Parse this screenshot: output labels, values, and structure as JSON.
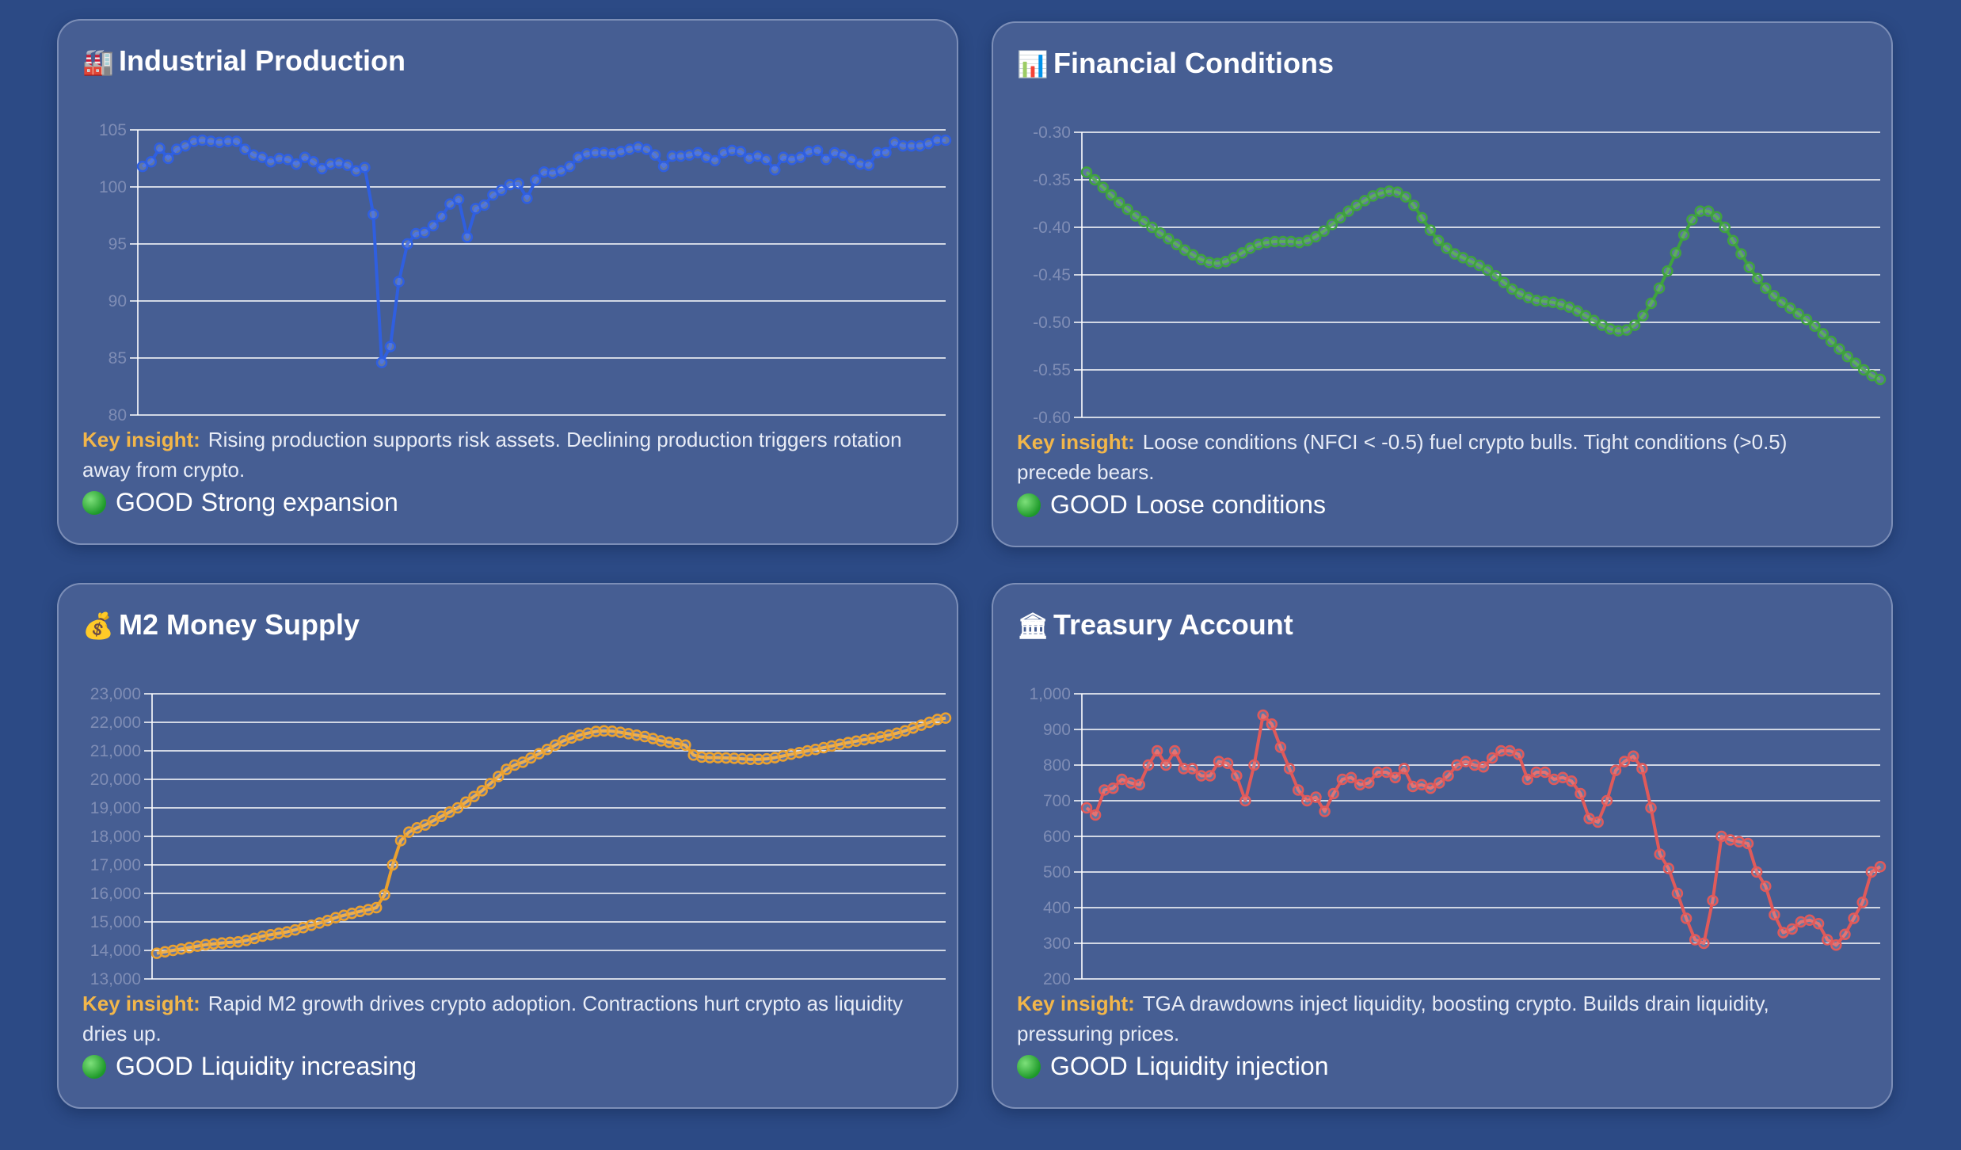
{
  "cards": [
    {
      "title": "Industrial Production",
      "icon": "🏭",
      "icon_name": "factory-icon",
      "insight_label": "Key insight:",
      "insight_text": "Rising production supports risk assets. Declining production triggers rotation away from crypto.",
      "status_word": "GOOD",
      "status_text": "Strong expansion",
      "status_icon": "green-circle-icon"
    },
    {
      "title": "Financial Conditions",
      "icon": "📊",
      "icon_name": "bar-chart-icon",
      "insight_label": "Key insight:",
      "insight_text": "Loose conditions (NFCI < -0.5) fuel crypto bulls. Tight conditions (>0.5) precede bears.",
      "status_word": "GOOD",
      "status_text": "Loose conditions",
      "status_icon": "green-circle-icon"
    },
    {
      "title": "M2 Money Supply",
      "icon": "💰",
      "icon_name": "money-bag-icon",
      "insight_label": "Key insight:",
      "insight_text": "Rapid M2 growth drives crypto adoption. Contractions hurt crypto as liquidity dries up.",
      "status_word": "GOOD",
      "status_text": "Liquidity increasing",
      "status_icon": "green-circle-icon"
    },
    {
      "title": "Treasury Account",
      "icon": "🏛",
      "icon_name": "bank-icon",
      "insight_label": "Key insight:",
      "insight_text": "TGA drawdowns inject liquidity, boosting crypto. Builds drain liquidity, pressuring prices.",
      "status_word": "GOOD",
      "status_text": "Liquidity injection",
      "status_icon": "green-circle-icon"
    }
  ],
  "chart_data": [
    {
      "type": "line",
      "color": "#2f5fe0",
      "ylim": [
        80,
        105
      ],
      "yticks": [
        80,
        85,
        90,
        95,
        100,
        105
      ],
      "y_tick_labels": [
        "80",
        "85",
        "90",
        "95",
        "100",
        "105"
      ],
      "grid": true,
      "series": [
        {
          "values": [
            101.8,
            102.2,
            103.4,
            102.5,
            103.3,
            103.6,
            104.0,
            104.1,
            104.0,
            103.9,
            104.0,
            104.0,
            103.3,
            102.8,
            102.6,
            102.2,
            102.5,
            102.4,
            102.0,
            102.6,
            102.2,
            101.6,
            102.0,
            102.1,
            101.9,
            101.4,
            101.7,
            97.6,
            84.6,
            86.0,
            91.7,
            95.0,
            95.9,
            96.0,
            96.6,
            97.4,
            98.5,
            98.9,
            95.6,
            98.1,
            98.4,
            99.3,
            99.7,
            100.2,
            100.3,
            99.0,
            100.6,
            101.3,
            101.2,
            101.4,
            101.8,
            102.6,
            102.9,
            103.0,
            103.0,
            102.9,
            103.1,
            103.3,
            103.5,
            103.3,
            102.8,
            101.8,
            102.7,
            102.7,
            102.8,
            103.0,
            102.6,
            102.3,
            103.0,
            103.2,
            103.1,
            102.5,
            102.7,
            102.4,
            101.5,
            102.6,
            102.4,
            102.6,
            103.1,
            103.2,
            102.4,
            103.0,
            102.8,
            102.4,
            102.0,
            101.9,
            103.0,
            103.0,
            103.9,
            103.6,
            103.6,
            103.6,
            103.8,
            104.1,
            104.1
          ]
        }
      ]
    },
    {
      "type": "line",
      "color": "#3fa23f",
      "ylim": [
        -0.6,
        -0.3
      ],
      "yticks": [
        -0.6,
        -0.55,
        -0.5,
        -0.45,
        -0.4,
        -0.35,
        -0.3
      ],
      "y_tick_labels": [
        "-0.60",
        "-0.55",
        "-0.50",
        "-0.45",
        "-0.40",
        "-0.35",
        "-0.30"
      ],
      "grid": true,
      "series": [
        {
          "values": [
            -0.342,
            -0.35,
            -0.358,
            -0.366,
            -0.374,
            -0.381,
            -0.388,
            -0.394,
            -0.4,
            -0.406,
            -0.412,
            -0.418,
            -0.424,
            -0.429,
            -0.434,
            -0.437,
            -0.438,
            -0.436,
            -0.432,
            -0.427,
            -0.422,
            -0.418,
            -0.416,
            -0.415,
            -0.415,
            -0.415,
            -0.416,
            -0.414,
            -0.41,
            -0.404,
            -0.397,
            -0.39,
            -0.383,
            -0.377,
            -0.372,
            -0.367,
            -0.364,
            -0.362,
            -0.363,
            -0.368,
            -0.377,
            -0.39,
            -0.403,
            -0.414,
            -0.422,
            -0.428,
            -0.432,
            -0.436,
            -0.44,
            -0.445,
            -0.451,
            -0.458,
            -0.465,
            -0.47,
            -0.474,
            -0.477,
            -0.478,
            -0.479,
            -0.481,
            -0.484,
            -0.488,
            -0.493,
            -0.498,
            -0.503,
            -0.507,
            -0.509,
            -0.508,
            -0.503,
            -0.493,
            -0.48,
            -0.464,
            -0.446,
            -0.427,
            -0.408,
            -0.392,
            -0.383,
            -0.383,
            -0.389,
            -0.4,
            -0.414,
            -0.428,
            -0.442,
            -0.454,
            -0.464,
            -0.472,
            -0.479,
            -0.485,
            -0.491,
            -0.497,
            -0.504,
            -0.512,
            -0.52,
            -0.528,
            -0.536,
            -0.543,
            -0.55,
            -0.556,
            -0.56
          ]
        }
      ]
    },
    {
      "type": "line",
      "color": "#eba12f",
      "ylim": [
        13000,
        23000
      ],
      "yticks": [
        13000,
        14000,
        15000,
        16000,
        17000,
        18000,
        19000,
        20000,
        21000,
        22000,
        23000
      ],
      "y_tick_labels": [
        "13,000",
        "14,000",
        "15,000",
        "16,000",
        "17,000",
        "18,000",
        "19,000",
        "20,000",
        "21,000",
        "22,000",
        "23,000"
      ],
      "grid": true,
      "series": [
        {
          "values": [
            13900,
            13950,
            14000,
            14050,
            14100,
            14150,
            14200,
            14230,
            14260,
            14280,
            14300,
            14350,
            14420,
            14500,
            14550,
            14600,
            14650,
            14720,
            14800,
            14880,
            14960,
            15050,
            15150,
            15230,
            15300,
            15370,
            15430,
            15500,
            15950,
            17000,
            17850,
            18150,
            18300,
            18400,
            18550,
            18700,
            18850,
            19000,
            19200,
            19400,
            19600,
            19850,
            20100,
            20350,
            20500,
            20600,
            20750,
            20900,
            21050,
            21200,
            21350,
            21450,
            21550,
            21620,
            21680,
            21700,
            21690,
            21650,
            21600,
            21550,
            21500,
            21430,
            21350,
            21300,
            21250,
            21200,
            20850,
            20780,
            20760,
            20760,
            20750,
            20740,
            20720,
            20700,
            20700,
            20720,
            20760,
            20820,
            20880,
            20940,
            21000,
            21050,
            21110,
            21170,
            21230,
            21290,
            21340,
            21390,
            21440,
            21490,
            21550,
            21620,
            21700,
            21800,
            21900,
            22000,
            22100,
            22150
          ]
        }
      ]
    },
    {
      "type": "line",
      "color": "#e05a5a",
      "ylim": [
        200,
        1000
      ],
      "yticks": [
        200,
        300,
        400,
        500,
        600,
        700,
        800,
        900,
        1000
      ],
      "y_tick_labels": [
        "200",
        "300",
        "400",
        "500",
        "600",
        "700",
        "800",
        "900",
        "1,000"
      ],
      "grid": true,
      "series": [
        {
          "values": [
            680,
            660,
            730,
            735,
            760,
            750,
            745,
            800,
            840,
            800,
            840,
            790,
            790,
            770,
            770,
            810,
            805,
            770,
            700,
            800,
            940,
            915,
            850,
            790,
            730,
            700,
            710,
            670,
            720,
            760,
            765,
            745,
            750,
            780,
            780,
            765,
            790,
            740,
            745,
            735,
            750,
            770,
            800,
            810,
            800,
            795,
            820,
            840,
            840,
            830,
            760,
            780,
            780,
            760,
            765,
            755,
            720,
            650,
            640,
            700,
            785,
            810,
            825,
            790,
            680,
            550,
            510,
            440,
            370,
            310,
            300,
            420,
            600,
            590,
            585,
            580,
            500,
            460,
            380,
            330,
            340,
            360,
            365,
            355,
            310,
            295,
            325,
            370,
            415,
            500,
            515
          ]
        }
      ]
    }
  ]
}
